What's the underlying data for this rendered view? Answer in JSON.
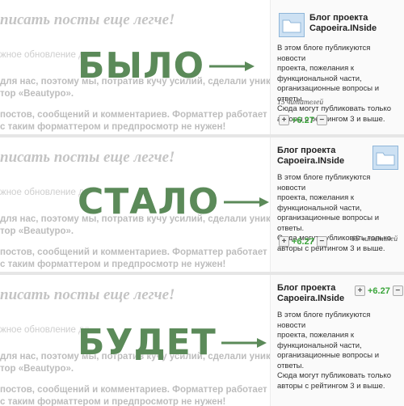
{
  "article": {
    "headline": "писать посты еще легче!",
    "line1": "жное обновление дл",
    "line2": "для нас, поэтому мы, потратив кучу усилий, сделали уникаль-",
    "line3": "тор «Beautypo».",
    "line4": "постов, сообщений и комментариев. Форматтер работает",
    "line5": "с таким форматтером и предпросмотр не нужен!"
  },
  "overlays": [
    "БЫЛО",
    "СТАЛО",
    "БУДЕТ"
  ],
  "card": {
    "title_line1": "Блог проекта",
    "title_line2": "Capoeira.INside",
    "desc_line1": "В этом блоге публикуются новости",
    "desc_line2": "проекта, пожелания к",
    "desc_line3": "функциональной части,",
    "desc_line4": "организационные вопросы и ответы.",
    "desc_line5": "Сюда могут публиковать только",
    "desc_line6": "авторы с рейтингом 3 и выше.",
    "readers": "15 читателей",
    "score": "+6.27",
    "plus": "+",
    "minus": "−"
  },
  "colors": {
    "overlay": "#5b8a59",
    "score": "#3aa53a",
    "folder": "#cde1f3"
  },
  "icons": {
    "folder": "folder-icon",
    "arrow": "arrow-right-icon"
  }
}
